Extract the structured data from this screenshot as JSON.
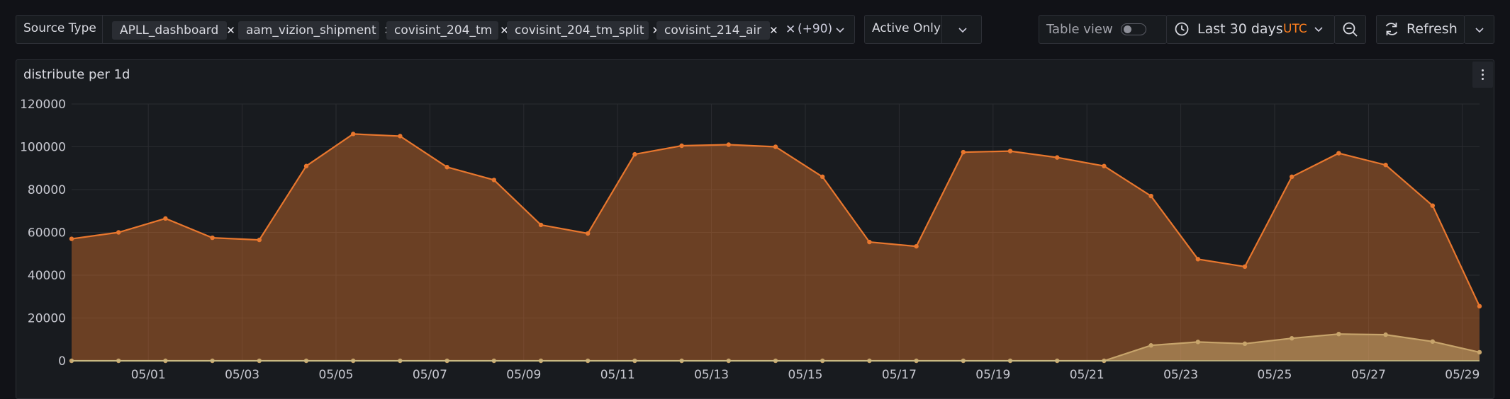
{
  "filters": {
    "source_type_label": "Source Type",
    "selected": [
      "APLL_dashboard",
      "aam_vizion_shipment",
      "covisint_204_tm",
      "covisint_204_tm_split",
      "covisint_214_air"
    ],
    "more_count": "(+90)",
    "active_only_label": "Active Only"
  },
  "toolbar": {
    "table_view_label": "Table view",
    "table_view_on": false,
    "time_range_label": "Last 30 days",
    "timezone_label": "UTC",
    "refresh_label": "Refresh"
  },
  "colors": {
    "accent": "#ff7f1e",
    "series_primary": "#e8772e",
    "series_secondary": "#c7a46b"
  },
  "panel": {
    "title": "distribute per 1d"
  },
  "chart_data": {
    "type": "area",
    "title": "distribute per 1d",
    "xlabel": "",
    "ylabel": "",
    "ylim": [
      0,
      120000
    ],
    "yticks": [
      0,
      20000,
      40000,
      60000,
      80000,
      100000,
      120000
    ],
    "xtick_labels": [
      "05/01",
      "05/03",
      "05/05",
      "05/07",
      "05/09",
      "05/11",
      "05/13",
      "05/15",
      "05/17",
      "05/19",
      "05/21",
      "05/23",
      "05/25",
      "05/27",
      "05/29"
    ],
    "grid": true,
    "legend": "none",
    "x": [
      "04/30",
      "05/01",
      "05/02",
      "05/03",
      "05/04",
      "05/05",
      "05/06",
      "05/07",
      "05/08",
      "05/09",
      "05/10",
      "05/11",
      "05/12",
      "05/13",
      "05/14",
      "05/15",
      "05/16",
      "05/17",
      "05/18",
      "05/19",
      "05/20",
      "05/21",
      "05/22",
      "05/23",
      "05/24",
      "05/25",
      "05/26",
      "05/27",
      "05/28",
      "05/29",
      "05/30"
    ],
    "series": [
      {
        "values": [
          57000,
          60000,
          66500,
          57500,
          56500,
          91000,
          106000,
          105000,
          90500,
          84500,
          63500,
          59500,
          96500,
          100500,
          101000,
          100000,
          86000,
          55500,
          53500,
          97500,
          98000,
          95000,
          91000,
          77000,
          47500,
          44000,
          86000,
          97000,
          91500,
          72500,
          25500
        ]
      },
      {
        "values": [
          0,
          0,
          0,
          0,
          0,
          0,
          0,
          0,
          0,
          0,
          0,
          0,
          0,
          0,
          0,
          0,
          0,
          0,
          0,
          0,
          0,
          0,
          0,
          7200,
          8800,
          8000,
          10500,
          12500,
          12200,
          9000,
          4000
        ]
      }
    ]
  }
}
